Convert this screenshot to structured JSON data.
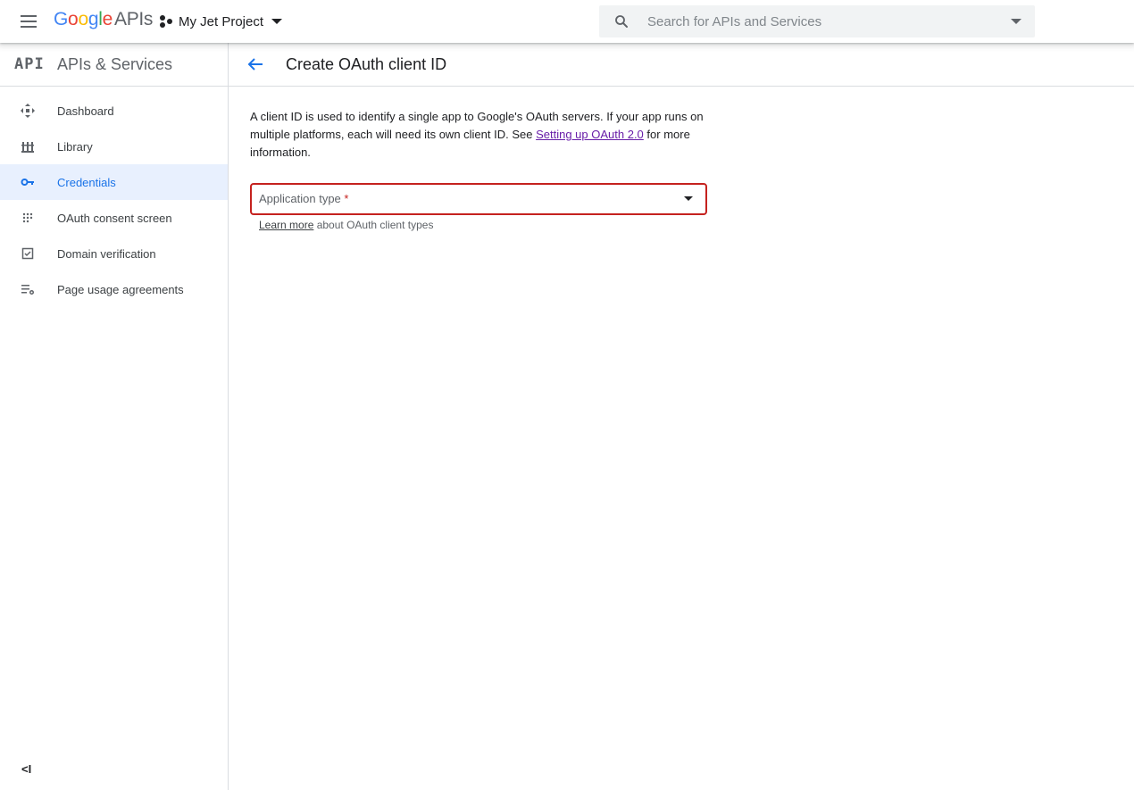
{
  "topbar": {
    "logo": {
      "google_letters": [
        {
          "ch": "G",
          "color": "#4285F4"
        },
        {
          "ch": "o",
          "color": "#EA4335"
        },
        {
          "ch": "o",
          "color": "#FBBC05"
        },
        {
          "ch": "g",
          "color": "#4285F4"
        },
        {
          "ch": "l",
          "color": "#34A853"
        },
        {
          "ch": "e",
          "color": "#EA4335"
        }
      ],
      "apis": "APIs"
    },
    "project_name": "My Jet Project",
    "search": {
      "placeholder": "Search for APIs and Services",
      "value": ""
    }
  },
  "sidebar": {
    "logo_text": "API",
    "title": "APIs & Services",
    "items": [
      {
        "label": "Dashboard",
        "icon": "dashboard-icon",
        "active": false
      },
      {
        "label": "Library",
        "icon": "library-icon",
        "active": false
      },
      {
        "label": "Credentials",
        "icon": "key-icon",
        "active": true
      },
      {
        "label": "OAuth consent screen",
        "icon": "consent-grid-icon",
        "active": false
      },
      {
        "label": "Domain verification",
        "icon": "checkbox-icon",
        "active": false
      },
      {
        "label": "Page usage agreements",
        "icon": "list-settings-icon",
        "active": false
      }
    ],
    "collapse_label": "<I"
  },
  "main": {
    "title": "Create OAuth client ID",
    "description": {
      "text_before": "A client ID is used to identify a single app to Google's OAuth servers. If your app runs on multiple platforms, each will need its own client ID. See ",
      "link": "Setting up OAuth 2.0",
      "text_after": " for more information."
    },
    "application_type": {
      "placeholder": "Application type",
      "required_mark": "*"
    },
    "hint": {
      "link": "Learn more",
      "text": " about OAuth client types"
    }
  },
  "colors": {
    "accent": "#1a73e8",
    "active_bg": "#e8f0fe",
    "error": "#c5221f",
    "visited_link": "#681da8"
  }
}
